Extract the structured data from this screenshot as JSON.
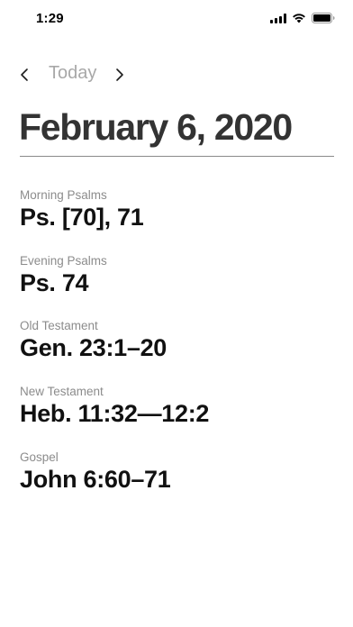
{
  "status_bar": {
    "time": "1:29"
  },
  "nav": {
    "prev_icon": "chevron-left-icon",
    "today_label": "Today",
    "next_icon": "chevron-right-icon"
  },
  "page": {
    "date_title": "February 6, 2020"
  },
  "readings": [
    {
      "label": "Morning Psalms",
      "reference": "Ps. [70], 71"
    },
    {
      "label": "Evening Psalms",
      "reference": "Ps. 74"
    },
    {
      "label": "Old Testament",
      "reference": "Gen. 23:1–20"
    },
    {
      "label": "New Testament",
      "reference": "Heb. 11:32—12:2"
    },
    {
      "label": "Gospel",
      "reference": "John 6:60–71"
    }
  ]
}
